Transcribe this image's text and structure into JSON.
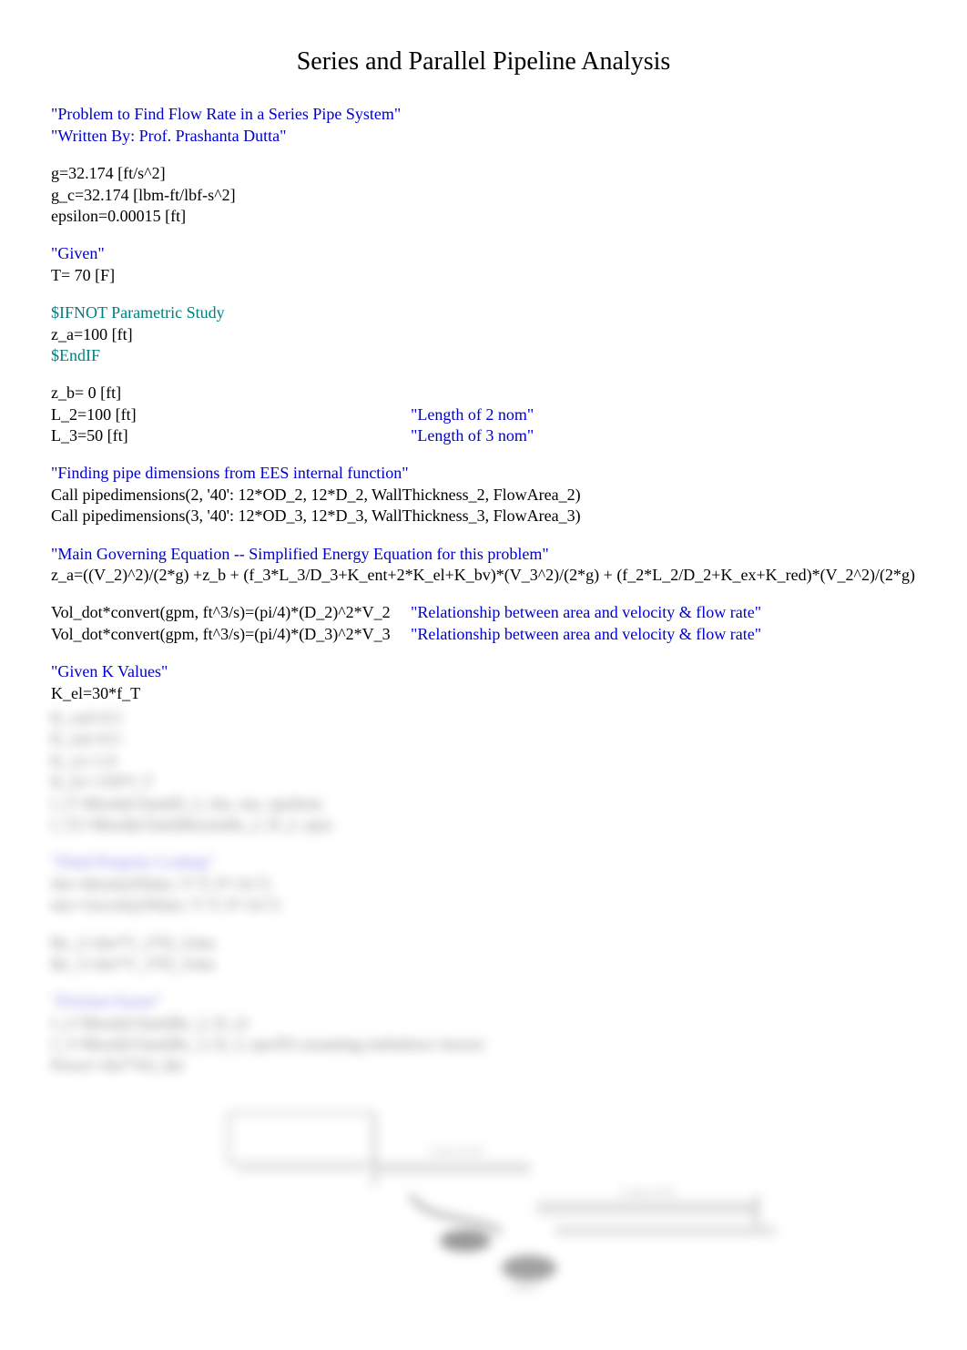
{
  "title": "Series and Parallel Pipeline Analysis",
  "header": {
    "problem": "\"Problem to Find Flow Rate in a Series Pipe System\"",
    "written_by": "\"Written By: Prof. Prashanta Dutta\""
  },
  "constants": {
    "g": "g=32.174 [ft/s^2]",
    "g_c": "g_c=32.174 [lbm-ft/lbf-s^2]",
    "epsilon": "epsilon=0.00015 [ft]"
  },
  "given_label": "\"Given\"",
  "given": {
    "T": "T= 70 [F]"
  },
  "directive_ifnot": "$IFNOT Parametric Study",
  "z_a": "z_a=100 [ft]",
  "directive_endif": "$EndIF",
  "z_b": "z_b= 0 [ft]",
  "L_2": "L_2=100 [ft]",
  "L_2_comment": "\"Length of 2 nom\"",
  "L_3": "L_3=50 [ft]",
  "L_3_comment": "\"Length of 3 nom\"",
  "section_pipe_dims": "\"Finding pipe dimensions from EES internal function\"",
  "call_pipe_2": "Call pipedimensions(2, '40': 12*OD_2, 12*D_2, WallThickness_2, FlowArea_2)",
  "call_pipe_3": "Call pipedimensions(3, '40': 12*OD_3, 12*D_3, WallThickness_3, FlowArea_3)",
  "section_main_eq": "\"Main Governing Equation -- Simplified Energy Equation for this problem\"",
  "main_eq_1": "z_a=((V_2)^2)/(2*g) +z_b + (f_3*L_3/D_3+K_ent+2*K_el+K_bv)*(V_3^2)/(2*g) + (f_2*L_2/D_2+K_ex+K_red)*(V_2^2)/(2*g)",
  "vol_dot_1": "Vol_dot*convert(gpm, ft^3/s)=(pi/4)*(D_2)^2*V_2",
  "vol_dot_1_comment": "\"Relationship between area and velocity & flow rate\"",
  "vol_dot_2": "Vol_dot*convert(gpm, ft^3/s)=(pi/4)*(D_3)^2*V_3",
  "vol_dot_2_comment": "\"Relationship between area and velocity & flow rate\"",
  "section_k_values": "\"Given K Values\"",
  "k_el": "K_el=30*f_T",
  "blurred": {
    "l1": "K_red=0.5",
    "l2": "K_ent=0.5",
    "l3": "K_ex=1.0",
    "l4": "K_bv=150*f_T",
    "l5": "f_T=MoodyChart(D_2, rho, mu, epsilon)",
    "l6": "f_T2=MoodyChart(Reynolds_2, D_2, eps)",
    "s2_head": "\"Fluid Property Lookup\"",
    "s2_l1": "rho=density(Water, T=T, P=14.7)",
    "s2_l2": "mu=viscosity(Water, T=T, P=14.7)",
    "s3_l1": "Re_2=rho*V_2*D_2/mu",
    "s3_l2": "Re_3=rho*V_3*D_3/mu",
    "s4_head": "\"Friction Factor\"",
    "s4_l1": "f_2=MoodyChart(Re_2, D_2)",
    "s4_l2": "f_3=MoodyChart(Re_3, D_3, eps/D3 assuming turbulence factor)",
    "s4_l3": "Power=rho*Vol_dot"
  }
}
